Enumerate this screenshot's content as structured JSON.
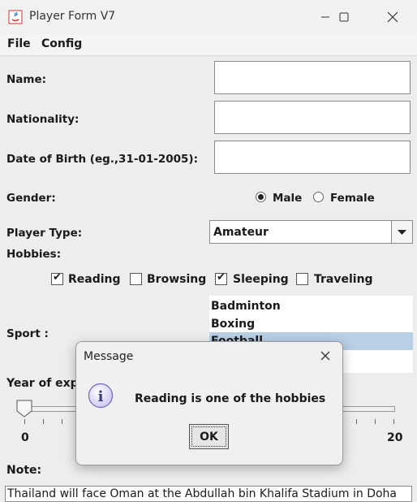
{
  "window": {
    "title": "Player Form V7"
  },
  "menu": {
    "items": [
      "File",
      "Config"
    ]
  },
  "form": {
    "name_label": "Name:",
    "name_value": "",
    "nationality_label": "Nationality:",
    "nationality_value": "",
    "dob_label": "Date of Birth (eg.,31-01-2005):",
    "dob_value": "",
    "gender_label": "Gender:",
    "gender_options": [
      {
        "label": "Male",
        "selected": true
      },
      {
        "label": "Female",
        "selected": false
      }
    ],
    "player_type_label": "Player Type:",
    "player_type_value": "Amateur",
    "hobbies_label": "Hobbies:",
    "hobbies": [
      {
        "label": "Reading",
        "checked": true
      },
      {
        "label": "Browsing",
        "checked": false
      },
      {
        "label": "Sleeping",
        "checked": true
      },
      {
        "label": "Traveling",
        "checked": false
      }
    ],
    "sport_label": "Sport :",
    "sports": [
      {
        "label": "Badminton",
        "selected": false
      },
      {
        "label": "Boxing",
        "selected": false
      },
      {
        "label": "Football",
        "selected": true
      }
    ],
    "experience_label": "Year of expe",
    "experience": {
      "min": "0",
      "max": "20",
      "value": 0
    },
    "note_label": "Note:",
    "note_value": "Thailand will face Oman at the Abdullah bin Khalifa Stadium in Doha"
  },
  "dialog": {
    "title": "Message",
    "message": "Reading is one of the hobbies",
    "ok_label": "OK",
    "icon": "info-icon"
  },
  "colors": {
    "selection": "#b8cfe5",
    "background": "#ededed"
  }
}
